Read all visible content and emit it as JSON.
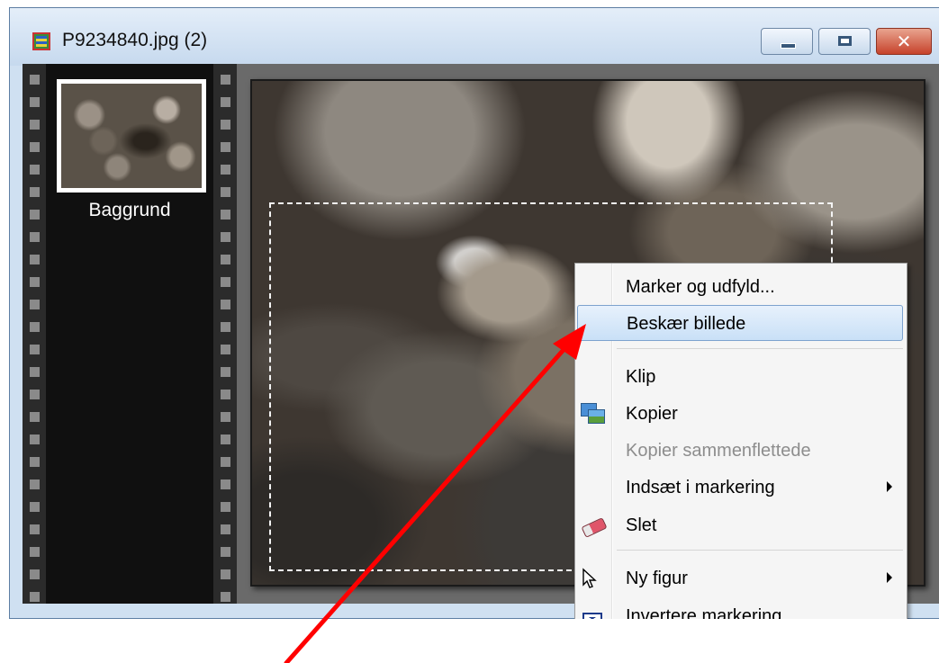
{
  "window": {
    "title": "P9234840.jpg (2)",
    "icon": "image-document-icon",
    "controls": {
      "minimize": "minimize-icon",
      "maximize": "maximize-icon",
      "close_glyph": "✕"
    }
  },
  "layers": {
    "items": [
      {
        "label": "Baggrund",
        "thumbnail": "pebbles-thumbnail"
      }
    ]
  },
  "context_menu": {
    "items": [
      {
        "label": "Marker og udfyld...",
        "enabled": true
      },
      {
        "label": "Beskær billede",
        "enabled": true,
        "highlighted": true
      },
      {
        "label": "Klip",
        "enabled": true
      },
      {
        "label": "Kopier",
        "enabled": true,
        "icon": "copy-icon"
      },
      {
        "label": "Kopier sammenflettede",
        "enabled": false
      },
      {
        "label": "Indsæt i markering",
        "enabled": true,
        "submenu": true
      },
      {
        "label": "Slet",
        "enabled": true,
        "icon": "eraser-icon"
      },
      {
        "label": "Ny figur",
        "enabled": true,
        "submenu": true,
        "icon": "cursor-icon"
      },
      {
        "label": "Invertere markering",
        "enabled": true,
        "icon": "text-cursor-icon"
      }
    ]
  },
  "annotation": {
    "arrow_color": "#ff0000"
  },
  "colors": {
    "highlight": "#c9e0f7",
    "filmstrip": "#101010",
    "title_bar": "#c6d9ee",
    "close_button": "#c6422b"
  }
}
